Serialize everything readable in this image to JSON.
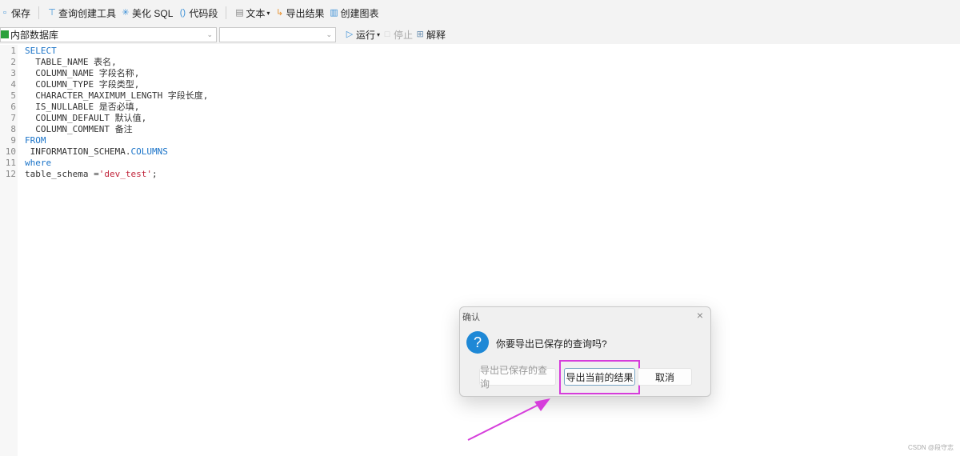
{
  "toolbar": {
    "save": "保存",
    "query_builder": "查询创建工具",
    "beautify": "美化 SQL",
    "snippet": "代码段",
    "text": "文本",
    "export": "导出结果",
    "chart": "创建图表"
  },
  "bar2": {
    "connection": "内部数据库",
    "database": "",
    "run": "运行",
    "stop": "停止",
    "explain": "解释"
  },
  "code": [
    {
      "n": "1",
      "t": [
        [
          "kw",
          "SELECT"
        ]
      ]
    },
    {
      "n": "2",
      "t": [
        [
          "pl",
          "  TABLE_NAME 表名,"
        ]
      ]
    },
    {
      "n": "3",
      "t": [
        [
          "pl",
          "  COLUMN_NAME 字段名称,"
        ]
      ]
    },
    {
      "n": "4",
      "t": [
        [
          "pl",
          "  COLUMN_TYPE 字段类型,"
        ]
      ]
    },
    {
      "n": "5",
      "t": [
        [
          "pl",
          "  CHARACTER_MAXIMUM_LENGTH 字段长度,"
        ]
      ]
    },
    {
      "n": "6",
      "t": [
        [
          "pl",
          "  IS_NULLABLE 是否必填,"
        ]
      ]
    },
    {
      "n": "7",
      "t": [
        [
          "pl",
          "  COLUMN_DEFAULT 默认值,"
        ]
      ]
    },
    {
      "n": "8",
      "t": [
        [
          "pl",
          "  COLUMN_COMMENT 备注"
        ]
      ]
    },
    {
      "n": "9",
      "t": [
        [
          "kw",
          "FROM"
        ]
      ]
    },
    {
      "n": "10",
      "t": [
        [
          "pl",
          " INFORMATION_SCHEMA."
        ],
        [
          "kw",
          "COLUMNS"
        ]
      ]
    },
    {
      "n": "11",
      "t": [
        [
          "kw",
          "where"
        ]
      ]
    },
    {
      "n": "12",
      "t": [
        [
          "pl",
          "table_schema ="
        ],
        [
          "str",
          "'dev_test'"
        ],
        [
          "pl",
          ";"
        ]
      ]
    }
  ],
  "dialog": {
    "title": "确认",
    "message": "你要导出已保存的查询吗?",
    "btn_saved": "导出已保存的查询",
    "btn_current": "导出当前的结果",
    "btn_cancel": "取消"
  },
  "watermark": "CSDN @段守志",
  "colors": {
    "highlight": "#d63ddb",
    "keyword": "#1a73c8",
    "string": "#c0243a"
  }
}
